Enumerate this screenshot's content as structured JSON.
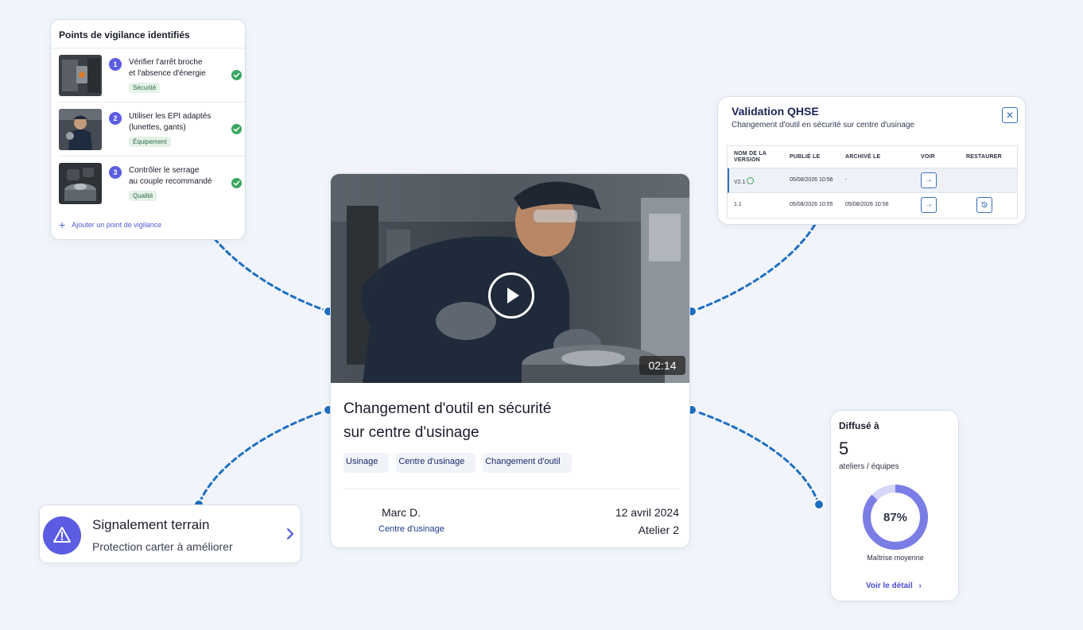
{
  "vigilance": {
    "title": "Points de vigilance identifiés",
    "items": [
      {
        "num": "1",
        "line1": "Vérifier l'arrêt broche",
        "line2": "et l'absence d'énergie",
        "tag": "Sécurité"
      },
      {
        "num": "2",
        "line1": "Utiliser les EPI adaptés",
        "line2": "(lunettes, gants)",
        "tag": "Équipement"
      },
      {
        "num": "3",
        "line1": "Contrôler le serrage",
        "line2": "au couple recommandé",
        "tag": "Qualité"
      }
    ],
    "add_label": "Ajouter un point de vigilance"
  },
  "validation": {
    "title": "Validation QHSE",
    "subtitle": "Changement d'outil en sécurité sur centre d'usinage",
    "headers": {
      "version_1": "NOM DE LA",
      "version_2": "VERSION",
      "published": "PUBLIÉ LE",
      "archived": "ARCHIVÉ LE",
      "view": "VOIR",
      "restore": "RESTAURER"
    },
    "rows": [
      {
        "version": "V2.1",
        "published": "05/08/2026 10:56",
        "archived": "-"
      },
      {
        "version": "1.1",
        "published": "05/08/2026 10:55",
        "archived": "05/08/2026 10:56"
      }
    ]
  },
  "video": {
    "duration": "02:14",
    "title_line1": "Changement d'outil en sécurité",
    "title_line2": "sur centre d'usinage",
    "tags": [
      "Usinage",
      "Centre d'usinage",
      "Changement d'outil"
    ],
    "author": "Marc D.",
    "author_team": "Centre d'usinage",
    "date": "12 avril 2024",
    "atelier": "Atelier 2"
  },
  "signal": {
    "title": "Signalement terrain",
    "subtitle": "Protection carter à améliorer"
  },
  "diffuse": {
    "title": "Diffusé à",
    "count": "5",
    "unit": "ateliers / équipes",
    "percent": 87,
    "percent_label": "87%",
    "level": "Maîtrise moyenne",
    "detail_label": "Voir le détail"
  },
  "colors": {
    "accent": "#5b5ce2",
    "connector": "#1f6fc0",
    "success": "#3aa760",
    "background": "#f1f5fb"
  },
  "icons": [
    "play-icon",
    "warning-icon",
    "chevron-right-icon",
    "check-circle-icon",
    "close-icon",
    "arrow-right-icon",
    "restore-icon",
    "plus-icon"
  ]
}
